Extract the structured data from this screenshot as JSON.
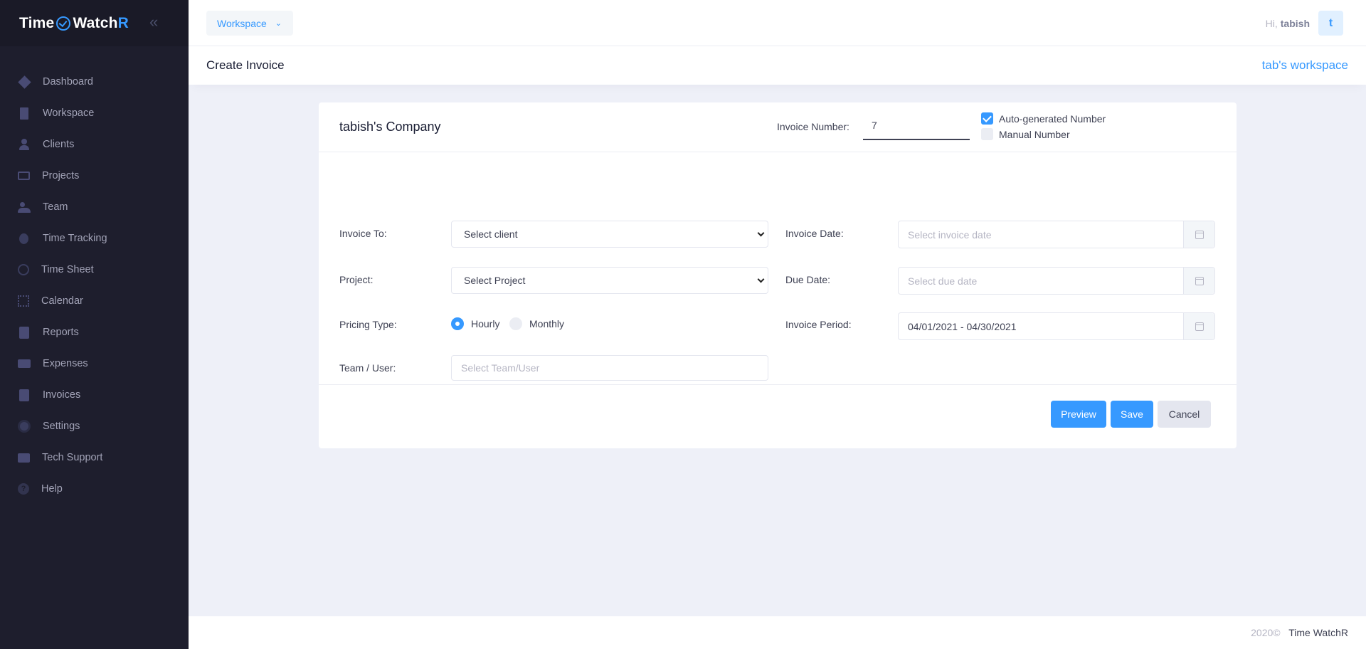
{
  "brand": {
    "part1": "Time",
    "part2": "Watch",
    "part3": "R"
  },
  "sidebar": {
    "items": [
      {
        "label": "Dashboard",
        "icon": "dashboard-icon"
      },
      {
        "label": "Workspace",
        "icon": "building-icon"
      },
      {
        "label": "Clients",
        "icon": "person-icon"
      },
      {
        "label": "Projects",
        "icon": "monitor-icon"
      },
      {
        "label": "Team",
        "icon": "group-icon"
      },
      {
        "label": "Time Tracking",
        "icon": "stopwatch-icon"
      },
      {
        "label": "Time Sheet",
        "icon": "clock-icon"
      },
      {
        "label": "Calendar",
        "icon": "calendar-icon"
      },
      {
        "label": "Reports",
        "icon": "document-icon"
      },
      {
        "label": "Expenses",
        "icon": "money-icon"
      },
      {
        "label": "Invoices",
        "icon": "invoice-icon"
      },
      {
        "label": "Settings",
        "icon": "gear-icon"
      },
      {
        "label": "Tech Support",
        "icon": "support-icon"
      },
      {
        "label": "Help",
        "icon": "help-icon"
      }
    ]
  },
  "header": {
    "workspace_dropdown": "Workspace",
    "greeting": "Hi,",
    "username": "tabish",
    "avatar_letter": "t"
  },
  "subheader": {
    "title": "Create Invoice",
    "workspace_link": "tab's workspace"
  },
  "invoice": {
    "company": "tabish's Company",
    "number_label": "Invoice Number:",
    "number_value": "7",
    "auto_label": "Auto-generated Number",
    "auto_checked": true,
    "manual_label": "Manual Number",
    "manual_checked": false,
    "invoice_to_label": "Invoice To:",
    "invoice_to_value": "Select client",
    "project_label": "Project:",
    "project_value": "Select Project",
    "pricing_label": "Pricing Type:",
    "pricing_options": [
      "Hourly",
      "Monthly"
    ],
    "pricing_selected": "Hourly",
    "team_label": "Team / User:",
    "team_placeholder": "Select Team/User",
    "invoice_date_label": "Invoice Date:",
    "invoice_date_placeholder": "Select invoice date",
    "due_date_label": "Due Date:",
    "due_date_placeholder": "Select due date",
    "period_label": "Invoice Period:",
    "period_value": "04/01/2021 - 04/30/2021"
  },
  "actions": {
    "preview": "Preview",
    "save": "Save",
    "cancel": "Cancel"
  },
  "footer": {
    "year": "2020©",
    "brand": "Time WatchR"
  },
  "colors": {
    "primary": "#3699ff",
    "sidebar": "#1e1e2d",
    "background": "#eef0f8"
  }
}
